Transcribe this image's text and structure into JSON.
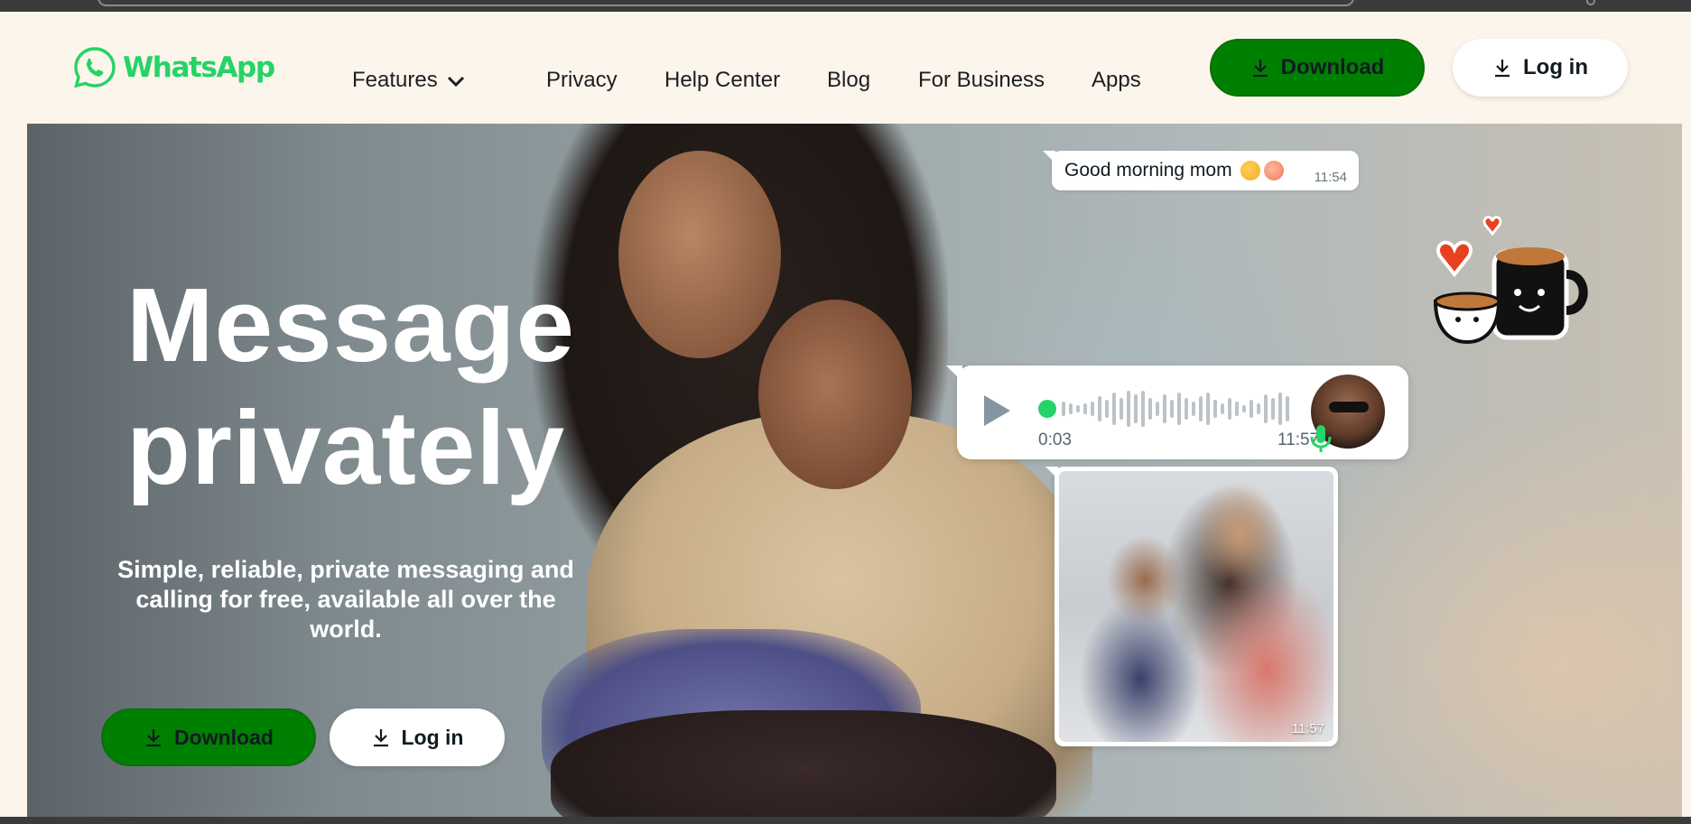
{
  "header": {
    "logo_text": "WhatsApp",
    "nav": {
      "features": "Features",
      "privacy": "Privacy",
      "help_center": "Help Center",
      "blog": "Blog",
      "for_business": "For Business",
      "apps": "Apps"
    },
    "download_label": "Download",
    "login_label": "Log in"
  },
  "hero": {
    "title_line1": "Message",
    "title_line2": "privately",
    "subtitle": "Simple, reliable, private messaging and calling for free, available all over the world.",
    "download_label": "Download",
    "login_label": "Log in"
  },
  "chat": {
    "message_text": "Good morning mom",
    "message_time": "11:54",
    "voice_duration": "0:03",
    "voice_time": "11:57",
    "photo_time": "11:57"
  },
  "colors": {
    "brand_green": "#25d366",
    "button_green": "#008000",
    "page_background": "#fcf5eb"
  }
}
